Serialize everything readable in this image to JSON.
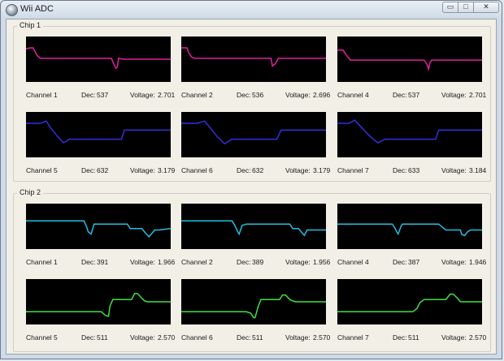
{
  "window": {
    "title": "Wii ADC",
    "controls": {
      "minimize": "▭",
      "maximize": "□",
      "close": "✕"
    }
  },
  "labels": {
    "dec": "Dec:",
    "voltage": "Voltage:"
  },
  "chips": [
    {
      "name": "Chip 1",
      "channels": [
        {
          "label": "Channel 1",
          "dec": "537",
          "voltage": "2.701",
          "color": "#e020a0",
          "trace": [
            [
              0,
              0.27
            ],
            [
              3,
              0.25
            ],
            [
              5,
              0.25
            ],
            [
              7,
              0.38
            ],
            [
              8,
              0.43
            ],
            [
              10,
              0.48
            ],
            [
              20,
              0.48
            ],
            [
              35,
              0.48
            ],
            [
              59,
              0.48
            ],
            [
              62,
              0.7
            ],
            [
              63,
              0.68
            ],
            [
              64,
              0.48
            ],
            [
              67,
              0.5
            ],
            [
              72,
              0.5
            ],
            [
              100,
              0.5
            ]
          ]
        },
        {
          "label": "Channel 2",
          "dec": "536",
          "voltage": "2.696",
          "color": "#e020a0",
          "trace": [
            [
              0,
              0.25
            ],
            [
              4,
              0.25
            ],
            [
              5,
              0.35
            ],
            [
              7,
              0.45
            ],
            [
              9,
              0.48
            ],
            [
              20,
              0.48
            ],
            [
              45,
              0.48
            ],
            [
              62,
              0.48
            ],
            [
              63,
              0.65
            ],
            [
              65,
              0.6
            ],
            [
              67,
              0.48
            ],
            [
              75,
              0.48
            ],
            [
              100,
              0.48
            ]
          ]
        },
        {
          "label": "Channel 4",
          "dec": "537",
          "voltage": "2.701",
          "color": "#e020a0",
          "trace": [
            [
              0,
              0.3
            ],
            [
              4,
              0.3
            ],
            [
              6,
              0.4
            ],
            [
              8,
              0.48
            ],
            [
              9,
              0.52
            ],
            [
              20,
              0.52
            ],
            [
              55,
              0.52
            ],
            [
              60,
              0.52
            ],
            [
              62,
              0.62
            ],
            [
              63,
              0.72
            ],
            [
              64,
              0.58
            ],
            [
              65,
              0.52
            ],
            [
              70,
              0.52
            ],
            [
              100,
              0.52
            ]
          ]
        },
        {
          "label": "Channel 5",
          "dec": "632",
          "voltage": "3.179",
          "color": "#3030e0",
          "trace": [
            [
              0,
              0.25
            ],
            [
              10,
              0.25
            ],
            [
              14,
              0.2
            ],
            [
              17,
              0.35
            ],
            [
              22,
              0.55
            ],
            [
              26,
              0.68
            ],
            [
              30,
              0.6
            ],
            [
              45,
              0.6
            ],
            [
              63,
              0.6
            ],
            [
              66,
              0.6
            ],
            [
              68,
              0.4
            ],
            [
              100,
              0.4
            ]
          ]
        },
        {
          "label": "Channel 6",
          "dec": "632",
          "voltage": "3.179",
          "color": "#3030e0",
          "trace": [
            [
              0,
              0.25
            ],
            [
              11,
              0.25
            ],
            [
              16,
              0.2
            ],
            [
              20,
              0.35
            ],
            [
              25,
              0.55
            ],
            [
              30,
              0.7
            ],
            [
              35,
              0.6
            ],
            [
              50,
              0.6
            ],
            [
              60,
              0.6
            ],
            [
              66,
              0.6
            ],
            [
              69,
              0.4
            ],
            [
              100,
              0.4
            ]
          ]
        },
        {
          "label": "Channel 7",
          "dec": "633",
          "voltage": "3.184",
          "color": "#3030e0",
          "trace": [
            [
              0,
              0.25
            ],
            [
              8,
              0.25
            ],
            [
              12,
              0.18
            ],
            [
              17,
              0.35
            ],
            [
              23,
              0.55
            ],
            [
              28,
              0.68
            ],
            [
              33,
              0.6
            ],
            [
              50,
              0.6
            ],
            [
              68,
              0.6
            ],
            [
              70,
              0.4
            ],
            [
              100,
              0.4
            ]
          ]
        }
      ]
    },
    {
      "name": "Chip 2",
      "channels": [
        {
          "label": "Channel 1",
          "dec": "391",
          "voltage": "1.966",
          "color": "#20c0e0",
          "trace": [
            [
              0,
              0.38
            ],
            [
              25,
              0.38
            ],
            [
              35,
              0.38
            ],
            [
              40,
              0.38
            ],
            [
              42,
              0.52
            ],
            [
              43,
              0.62
            ],
            [
              45,
              0.67
            ],
            [
              47,
              0.45
            ],
            [
              55,
              0.45
            ],
            [
              70,
              0.45
            ],
            [
              72,
              0.55
            ],
            [
              75,
              0.55
            ],
            [
              80,
              0.55
            ],
            [
              83,
              0.66
            ],
            [
              85,
              0.73
            ],
            [
              89,
              0.58
            ],
            [
              92,
              0.58
            ],
            [
              100,
              0.55
            ]
          ]
        },
        {
          "label": "Channel 2",
          "dec": "389",
          "voltage": "1.956",
          "color": "#20c0e0",
          "trace": [
            [
              0,
              0.38
            ],
            [
              25,
              0.38
            ],
            [
              35,
              0.38
            ],
            [
              37,
              0.48
            ],
            [
              39,
              0.62
            ],
            [
              40,
              0.67
            ],
            [
              42,
              0.48
            ],
            [
              45,
              0.45
            ],
            [
              75,
              0.45
            ],
            [
              77,
              0.55
            ],
            [
              81,
              0.55
            ],
            [
              84,
              0.66
            ],
            [
              85,
              0.7
            ],
            [
              87,
              0.58
            ],
            [
              100,
              0.58
            ]
          ]
        },
        {
          "label": "Channel 4",
          "dec": "387",
          "voltage": "1.946",
          "color": "#20c0e0",
          "trace": [
            [
              0,
              0.45
            ],
            [
              35,
              0.45
            ],
            [
              38,
              0.45
            ],
            [
              40,
              0.55
            ],
            [
              41,
              0.62
            ],
            [
              42,
              0.67
            ],
            [
              44,
              0.5
            ],
            [
              45,
              0.45
            ],
            [
              70,
              0.45
            ],
            [
              75,
              0.58
            ],
            [
              85,
              0.58
            ],
            [
              86,
              0.68
            ],
            [
              88,
              0.7
            ],
            [
              90,
              0.62
            ],
            [
              92,
              0.58
            ],
            [
              100,
              0.58
            ]
          ]
        },
        {
          "label": "Channel 5",
          "dec": "511",
          "voltage": "2.570",
          "color": "#40e040",
          "trace": [
            [
              0,
              0.72
            ],
            [
              40,
              0.72
            ],
            [
              50,
              0.72
            ],
            [
              52,
              0.72
            ],
            [
              55,
              0.8
            ],
            [
              57,
              0.82
            ],
            [
              58,
              0.6
            ],
            [
              60,
              0.45
            ],
            [
              62,
              0.45
            ],
            [
              73,
              0.45
            ],
            [
              75,
              0.32
            ],
            [
              77,
              0.32
            ],
            [
              80,
              0.42
            ],
            [
              82,
              0.48
            ],
            [
              84,
              0.5
            ],
            [
              100,
              0.5
            ]
          ]
        },
        {
          "label": "Channel 6",
          "dec": "511",
          "voltage": "2.570",
          "color": "#40e040",
          "trace": [
            [
              0,
              0.72
            ],
            [
              45,
              0.72
            ],
            [
              48,
              0.75
            ],
            [
              50,
              0.85
            ],
            [
              51,
              0.85
            ],
            [
              53,
              0.62
            ],
            [
              55,
              0.45
            ],
            [
              61,
              0.45
            ],
            [
              68,
              0.45
            ],
            [
              70,
              0.35
            ],
            [
              72,
              0.35
            ],
            [
              75,
              0.45
            ],
            [
              77,
              0.48
            ],
            [
              79,
              0.5
            ],
            [
              100,
              0.5
            ]
          ]
        },
        {
          "label": "Channel 7",
          "dec": "511",
          "voltage": "2.570",
          "color": "#40e040",
          "trace": [
            [
              0,
              0.72
            ],
            [
              45,
              0.72
            ],
            [
              50,
              0.72
            ],
            [
              52,
              0.72
            ],
            [
              55,
              0.65
            ],
            [
              57,
              0.52
            ],
            [
              60,
              0.45
            ],
            [
              75,
              0.45
            ],
            [
              78,
              0.33
            ],
            [
              80,
              0.33
            ],
            [
              83,
              0.42
            ],
            [
              85,
              0.5
            ],
            [
              100,
              0.5
            ]
          ]
        }
      ]
    }
  ]
}
